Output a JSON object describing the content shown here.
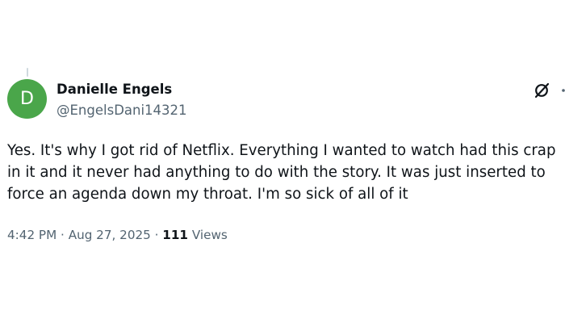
{
  "author": {
    "avatar_initial": "D",
    "avatar_color": "#4aa64a",
    "display_name": "Danielle Engels",
    "handle": "@EngelsDani14321"
  },
  "icons": {
    "grok": "grok-icon",
    "more": "more-options-icon"
  },
  "tweet": {
    "lines": [
      "Yes. It's why I got rid of Netflix. Everything I wanted to watch had this crap",
      "in it and it never had anything to do with the story. It was just inserted to",
      "force an agenda down my throat. I'm so sick of all of it"
    ]
  },
  "meta": {
    "time": "4:42 PM",
    "separator": "·",
    "date": "Aug 27, 2025",
    "views_count": "111",
    "views_label": "Views"
  }
}
